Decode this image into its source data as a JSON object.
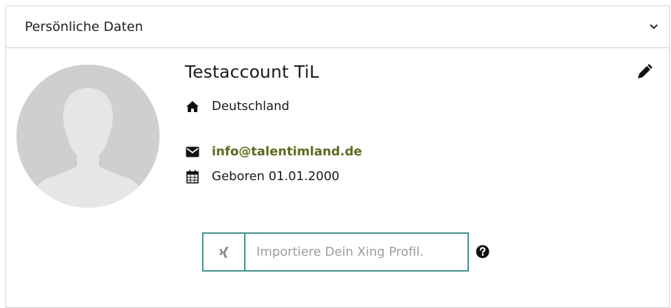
{
  "section": {
    "title": "Persönliche Daten",
    "toggle_icon": "chevron-down-icon"
  },
  "profile": {
    "name": "Testaccount TiL",
    "country": "Deutschland",
    "email": "info@talentimland.de",
    "birth": "Geboren 01.01.2000",
    "edit_icon": "pencil-icon"
  },
  "xing": {
    "placeholder": "Importiere Dein Xing Profil.",
    "value": "",
    "icon": "xing-icon",
    "help_icon": "question-circle-icon"
  },
  "colors": {
    "link": "#5d6b1f",
    "xing_border": "#3f8f8a",
    "avatar_bg": "#cfcfcf",
    "border": "#cfcfcf"
  }
}
